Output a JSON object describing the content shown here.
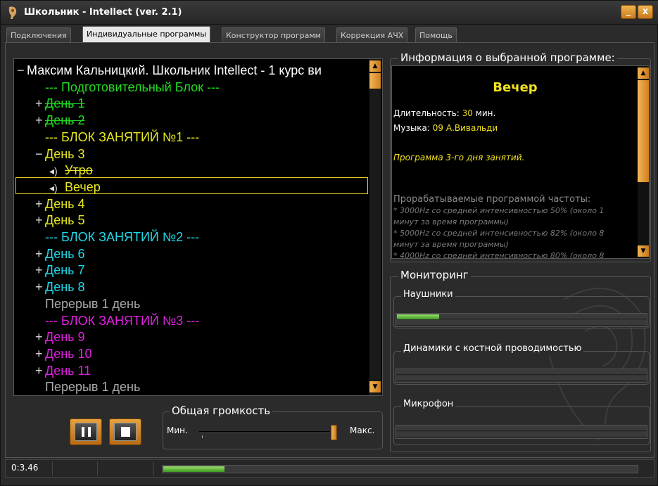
{
  "window": {
    "title": "Школьник - Intellect  (ver. 2.1)",
    "minimize_label": "_",
    "close_label": "x"
  },
  "tabs": [
    {
      "label": "Подключения",
      "active": false
    },
    {
      "label": "Индивидуальные программы",
      "active": true
    },
    {
      "label": "Конструктор программ",
      "active": false
    },
    {
      "label": "Коррекция АЧХ",
      "active": false
    },
    {
      "label": "Помощь",
      "active": false
    }
  ],
  "tree": {
    "rows": [
      {
        "expander": "−",
        "text": "Максим Кальницкий. Школьник Intellect - 1 курс ви",
        "color": "#ffffff",
        "strike": false,
        "icon": "",
        "indent": 1
      },
      {
        "expander": "",
        "text": "---  Подготовительный Блок ---",
        "color": "#22dd22",
        "strike": false,
        "icon": "",
        "indent": 2
      },
      {
        "expander": "+",
        "text": "День 1",
        "color": "#22dd22",
        "strike": true,
        "icon": "",
        "indent": 2
      },
      {
        "expander": "+",
        "text": "День 2",
        "color": "#22dd22",
        "strike": true,
        "icon": "",
        "indent": 2
      },
      {
        "expander": "",
        "text": "--- БЛОК ЗАНЯТИЙ №1 ---",
        "color": "#e8e820",
        "strike": false,
        "icon": "",
        "indent": 2
      },
      {
        "expander": "−",
        "text": "День 3",
        "color": "#e8e820",
        "strike": false,
        "icon": "",
        "indent": 2
      },
      {
        "expander": "",
        "text": "Утро",
        "color": "#e8e820",
        "strike": true,
        "icon": "speaker-icon",
        "indent": 3
      },
      {
        "expander": "",
        "text": "Вечер",
        "color": "#e8e820",
        "strike": false,
        "icon": "speaker-icon",
        "indent": 3
      },
      {
        "expander": "+",
        "text": "День 4",
        "color": "#e8e820",
        "strike": false,
        "icon": "",
        "indent": 2
      },
      {
        "expander": "+",
        "text": "День 5",
        "color": "#e8e820",
        "strike": false,
        "icon": "",
        "indent": 2
      },
      {
        "expander": "",
        "text": "--- БЛОК ЗАНЯТИЙ №2 ---",
        "color": "#22d8e8",
        "strike": false,
        "icon": "",
        "indent": 2
      },
      {
        "expander": "+",
        "text": "День 6",
        "color": "#22d8e8",
        "strike": false,
        "icon": "",
        "indent": 2
      },
      {
        "expander": "+",
        "text": "День 7",
        "color": "#22d8e8",
        "strike": false,
        "icon": "",
        "indent": 2
      },
      {
        "expander": "+",
        "text": "День 8",
        "color": "#22d8e8",
        "strike": false,
        "icon": "",
        "indent": 2
      },
      {
        "expander": "",
        "text": "Перерыв 1 день",
        "color": "#aaaaaa",
        "strike": false,
        "icon": "",
        "indent": 2
      },
      {
        "expander": "",
        "text": "--- БЛОК ЗАНЯТИЙ №3 ---",
        "color": "#e020e0",
        "strike": false,
        "icon": "",
        "indent": 2
      },
      {
        "expander": "+",
        "text": "День 9",
        "color": "#e020e0",
        "strike": false,
        "icon": "",
        "indent": 2
      },
      {
        "expander": "+",
        "text": "День 10",
        "color": "#e020e0",
        "strike": false,
        "icon": "",
        "indent": 2
      },
      {
        "expander": "+",
        "text": "День 11",
        "color": "#e020e0",
        "strike": false,
        "icon": "",
        "indent": 2
      },
      {
        "expander": "",
        "text": "Перерыв 1 день",
        "color": "#aaaaaa",
        "strike": false,
        "icon": "",
        "indent": 2
      }
    ],
    "selected": "Вечер"
  },
  "playback": {
    "pause_icon": "pause-icon",
    "stop_icon": "stop-icon",
    "volume_label": "Общая громкость",
    "volume_min": "Мин.",
    "volume_max": "Макс.",
    "volume_level": 1.0
  },
  "info": {
    "group_label": "Информация о выбранной программе:",
    "program_name": "Вечер",
    "duration_label": "Длительность: ",
    "duration_value": "30",
    "duration_unit": " мин.",
    "music_label": "Музыка: ",
    "music_value": "09 А.Вивальди",
    "description": "Программа 3-го дня занятий.",
    "freq_header": "Прорабатываемые программой частоты:",
    "freq_lines": [
      "* 3000Hz со средней интенсивностью 50% (около 1",
      "минут за время программы)",
      "* 5000Hz со средней интенсивностью 82% (около 8",
      "минут за время программы)",
      "* 4000Hz со средней интенсивностью 80% (около 8"
    ]
  },
  "monitoring": {
    "group_label": "Мониторинг",
    "channels": [
      {
        "label": "Наушники",
        "level": 0.17
      },
      {
        "label": "Динамики с костной проводимостью",
        "level": 0.0
      },
      {
        "label": "Микрофон",
        "level": 0.0
      }
    ]
  },
  "status": {
    "time": "0:3.46",
    "progress": 0.13
  },
  "colors": {
    "accent": "#e8a23c",
    "meter_green": "#5cc03a"
  }
}
